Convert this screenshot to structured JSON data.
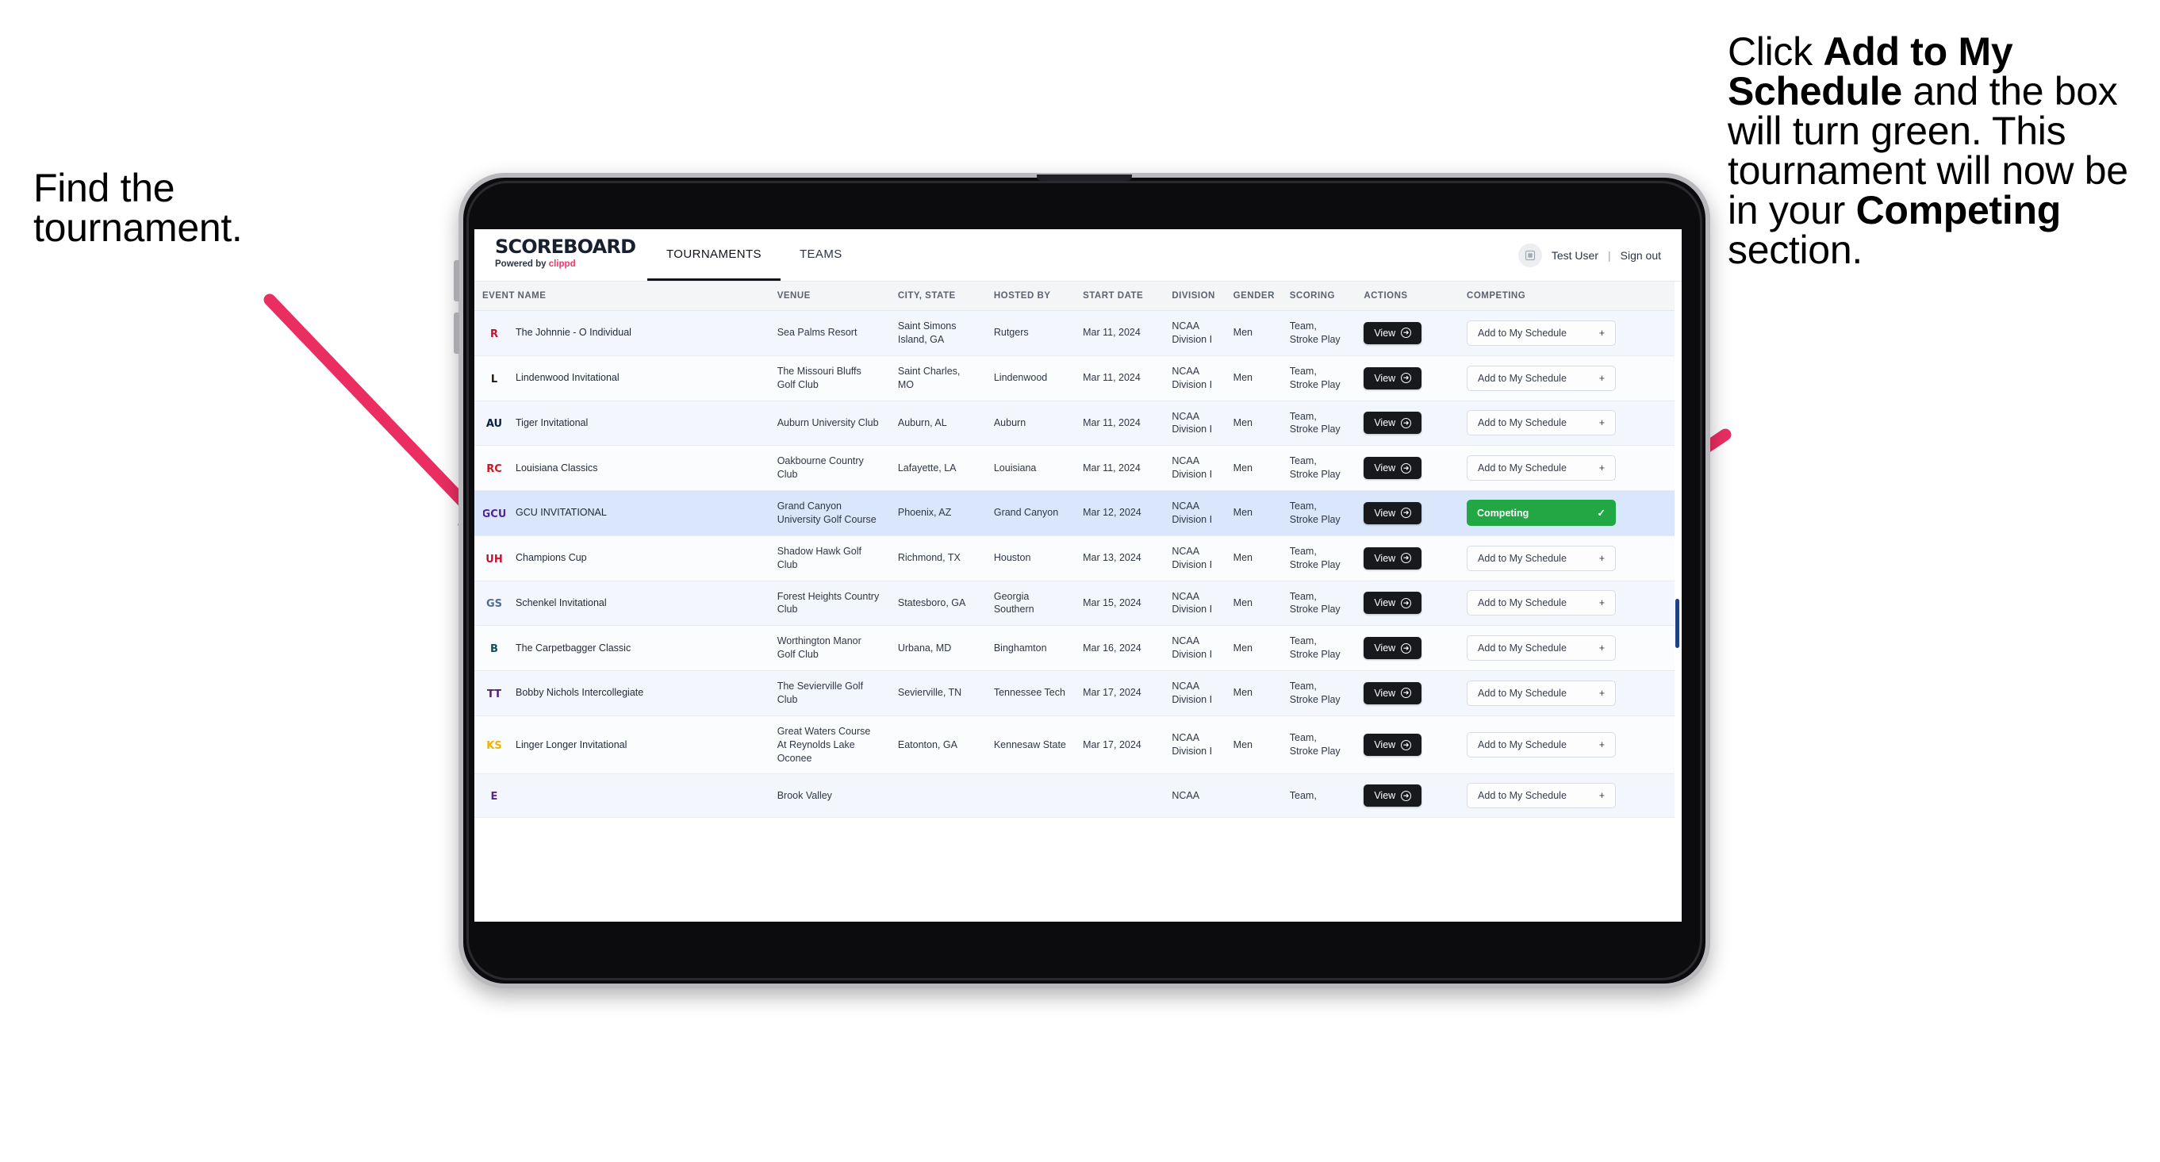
{
  "annotations": {
    "left": {
      "line1": "Find the",
      "line2": "tournament."
    },
    "right": {
      "part1": "Click ",
      "bold1": "Add to My Schedule",
      "part2": " and the box will turn green. This tournament will now be in your ",
      "bold2": "Competing",
      "part3": " section."
    },
    "arrow_color": "#ea2e62"
  },
  "app": {
    "brand": {
      "title": "SCOREBOARD",
      "powered_prefix": "Powered by ",
      "powered_brand": "clippd",
      "brand_color": "#f2336b"
    },
    "nav": {
      "tabs": [
        {
          "label": "TOURNAMENTS",
          "active": true
        },
        {
          "label": "TEAMS",
          "active": false
        }
      ]
    },
    "header_right": {
      "avatar_icon": "user-avatar-icon",
      "user_name": "Test User",
      "separator": "|",
      "sign_out": "Sign out"
    }
  },
  "table": {
    "columns": [
      "EVENT NAME",
      "VENUE",
      "CITY, STATE",
      "HOSTED BY",
      "START DATE",
      "DIVISION",
      "GENDER",
      "SCORING",
      "ACTIONS",
      "COMPETING"
    ],
    "view_label": "View",
    "add_label": "Add to My Schedule",
    "add_icon": "plus-icon",
    "competing_label": "Competing",
    "competing_icon": "check-icon",
    "competing_color": "#22a745",
    "rows": [
      {
        "logo": "rutgers-logo-icon",
        "logo_text": "R",
        "logo_color": "#c8102e",
        "event": "The Johnnie - O Individual",
        "venue": "Sea Palms Resort",
        "city_state": "Saint Simons Island, GA",
        "hosted_by": "Rutgers",
        "start_date": "Mar 11, 2024",
        "division": "NCAA Division I",
        "gender": "Men",
        "scoring": "Team, Stroke Play",
        "competing": false
      },
      {
        "logo": "lindenwood-lion-logo-icon",
        "logo_text": "L",
        "logo_color": "#1f1a14",
        "event": "Lindenwood Invitational",
        "venue": "The Missouri Bluffs Golf Club",
        "city_state": "Saint Charles, MO",
        "hosted_by": "Lindenwood",
        "start_date": "Mar 11, 2024",
        "division": "NCAA Division I",
        "gender": "Men",
        "scoring": "Team, Stroke Play",
        "competing": false
      },
      {
        "logo": "auburn-au-logo-icon",
        "logo_text": "AU",
        "logo_color": "#0c2340",
        "event": "Tiger Invitational",
        "venue": "Auburn University Club",
        "city_state": "Auburn, AL",
        "hosted_by": "Auburn",
        "start_date": "Mar 11, 2024",
        "division": "NCAA Division I",
        "gender": "Men",
        "scoring": "Team, Stroke Play",
        "competing": false
      },
      {
        "logo": "louisiana-ragin-cajuns-logo-icon",
        "logo_text": "RC",
        "logo_color": "#ce181e",
        "event": "Louisiana Classics",
        "venue": "Oakbourne Country Club",
        "city_state": "Lafayette, LA",
        "hosted_by": "Louisiana",
        "start_date": "Mar 11, 2024",
        "division": "NCAA Division I",
        "gender": "Men",
        "scoring": "Team, Stroke Play",
        "competing": false
      },
      {
        "logo": "grand-canyon-lopes-logo-icon",
        "logo_text": "GCU",
        "logo_color": "#522398",
        "event": "GCU INVITATIONAL",
        "venue": "Grand Canyon University Golf Course",
        "city_state": "Phoenix, AZ",
        "hosted_by": "Grand Canyon",
        "start_date": "Mar 12, 2024",
        "division": "NCAA Division I",
        "gender": "Men",
        "scoring": "Team, Stroke Play",
        "competing": true
      },
      {
        "logo": "houston-cougars-logo-icon",
        "logo_text": "UH",
        "logo_color": "#c8102e",
        "event": "Champions Cup",
        "venue": "Shadow Hawk Golf Club",
        "city_state": "Richmond, TX",
        "hosted_by": "Houston",
        "start_date": "Mar 13, 2024",
        "division": "NCAA Division I",
        "gender": "Men",
        "scoring": "Team, Stroke Play",
        "competing": false
      },
      {
        "logo": "georgia-southern-eagles-logo-icon",
        "logo_text": "GS",
        "logo_color": "#4f6d8f",
        "event": "Schenkel Invitational",
        "venue": "Forest Heights Country Club",
        "city_state": "Statesboro, GA",
        "hosted_by": "Georgia Southern",
        "start_date": "Mar 15, 2024",
        "division": "NCAA Division I",
        "gender": "Men",
        "scoring": "Team, Stroke Play",
        "competing": false
      },
      {
        "logo": "binghamton-bearcats-logo-icon",
        "logo_text": "B",
        "logo_color": "#0d5257",
        "event": "The Carpetbagger Classic",
        "venue": "Worthington Manor Golf Club",
        "city_state": "Urbana, MD",
        "hosted_by": "Binghamton",
        "start_date": "Mar 16, 2024",
        "division": "NCAA Division I",
        "gender": "Men",
        "scoring": "Team, Stroke Play",
        "competing": false
      },
      {
        "logo": "tennessee-tech-golden-eagles-logo-icon",
        "logo_text": "TT",
        "logo_color": "#4f2170",
        "event": "Bobby Nichols Intercollegiate",
        "venue": "The Sevierville Golf Club",
        "city_state": "Sevierville, TN",
        "hosted_by": "Tennessee Tech",
        "start_date": "Mar 17, 2024",
        "division": "NCAA Division I",
        "gender": "Men",
        "scoring": "Team, Stroke Play",
        "competing": false
      },
      {
        "logo": "kennesaw-state-owls-logo-icon",
        "logo_text": "KS",
        "logo_color": "#f1b300",
        "event": "Linger Longer Invitational",
        "venue": "Great Waters Course At Reynolds Lake Oconee",
        "city_state": "Eatonton, GA",
        "hosted_by": "Kennesaw State",
        "start_date": "Mar 17, 2024",
        "division": "NCAA Division I",
        "gender": "Men",
        "scoring": "Team, Stroke Play",
        "competing": false
      },
      {
        "logo": "ecu-pirates-logo-icon",
        "logo_text": "E",
        "logo_color": "#592a8a",
        "event": "",
        "venue": "Brook Valley",
        "city_state": "",
        "hosted_by": "",
        "start_date": "",
        "division": "NCAA",
        "gender": "",
        "scoring": "Team,",
        "competing": false,
        "clipped": true
      }
    ]
  }
}
